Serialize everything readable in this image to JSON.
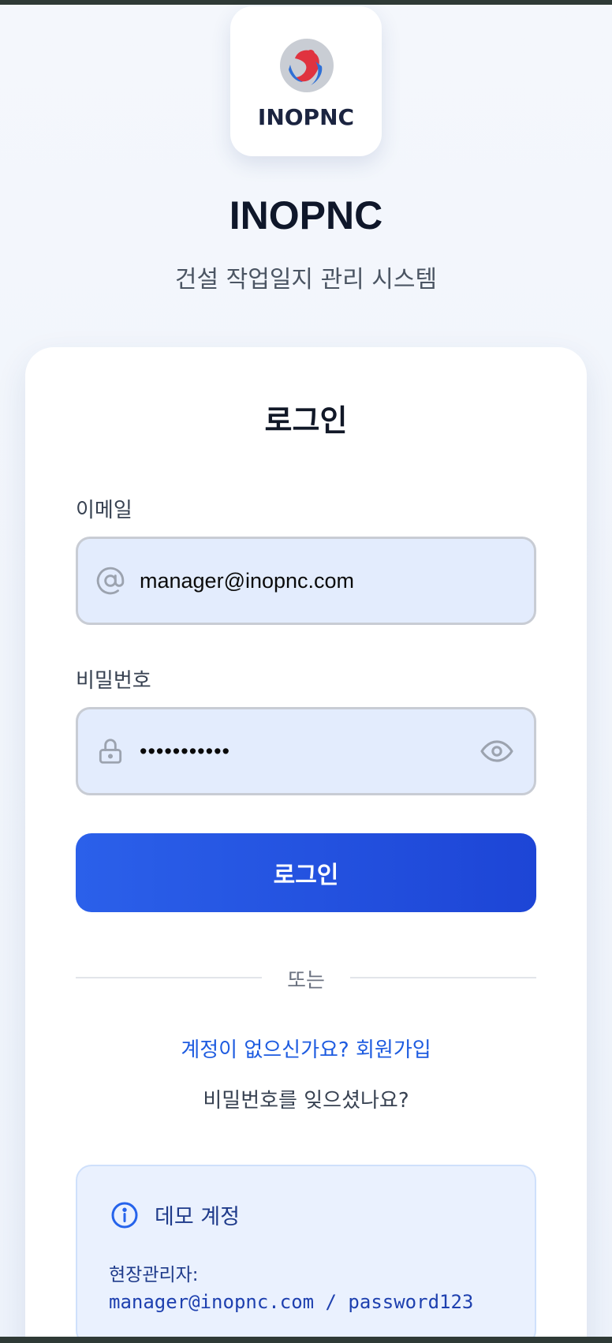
{
  "brand": {
    "logo_text": "INOPNC",
    "title": "INOPNC",
    "subtitle": "건설 작업일지 관리 시스템"
  },
  "login_card": {
    "title": "로그인",
    "email": {
      "label": "이메일",
      "value": "manager@inopnc.com",
      "icon": "at-sign-icon"
    },
    "password": {
      "label": "비밀번호",
      "value": "password123",
      "icon": "lock-icon",
      "toggle_icon": "eye-icon"
    },
    "submit_label": "로그인",
    "divider_text": "또는",
    "signup_link": "계정이 없으신가요? 회원가입",
    "forgot_link": "비밀번호를 잊으셨나요?"
  },
  "demo": {
    "icon": "info-icon",
    "title": "데모 계정",
    "role": "현장관리자:",
    "credentials": "manager@inopnc.com / password123"
  },
  "colors": {
    "primary": "#2b60ea",
    "primary_dark": "#1d45d6",
    "link": "#1d5be0",
    "input_bg": "#e3ecfd",
    "demo_bg": "#eaf1fe",
    "logo_red": "#e0333f",
    "logo_blue": "#2e6fd6"
  }
}
